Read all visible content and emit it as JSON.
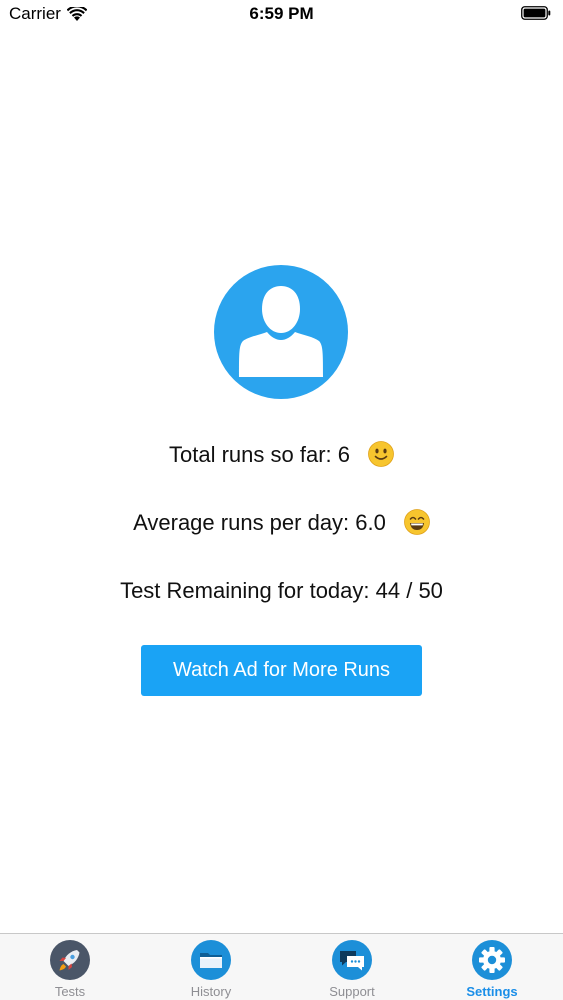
{
  "status_bar": {
    "carrier": "Carrier",
    "time": "6:59 PM",
    "wifi_icon": "wifi-icon",
    "battery_icon": "battery-full-icon"
  },
  "profile": {
    "avatar_icon": "user-avatar-icon",
    "accent_color": "#2ba4ee"
  },
  "stats": {
    "total_runs": "Total runs so far: 6",
    "total_runs_emoji": "slightly-smiling-face-icon",
    "average_runs": "Average runs per day: 6.0",
    "average_runs_emoji": "grinning-face-icon",
    "remaining": "Test Remaining for today: 44 / 50"
  },
  "actions": {
    "watch_ad_label": "Watch Ad for More Runs",
    "button_color": "#1aa3f5"
  },
  "tab_bar": {
    "tabs": [
      {
        "label": "Tests",
        "icon": "rocket-icon",
        "active": false
      },
      {
        "label": "History",
        "icon": "folder-icon",
        "active": false
      },
      {
        "label": "Support",
        "icon": "chat-bubbles-icon",
        "active": false
      },
      {
        "label": "Settings",
        "icon": "gear-icon",
        "active": true
      }
    ],
    "active_color": "#1a8ee8"
  }
}
